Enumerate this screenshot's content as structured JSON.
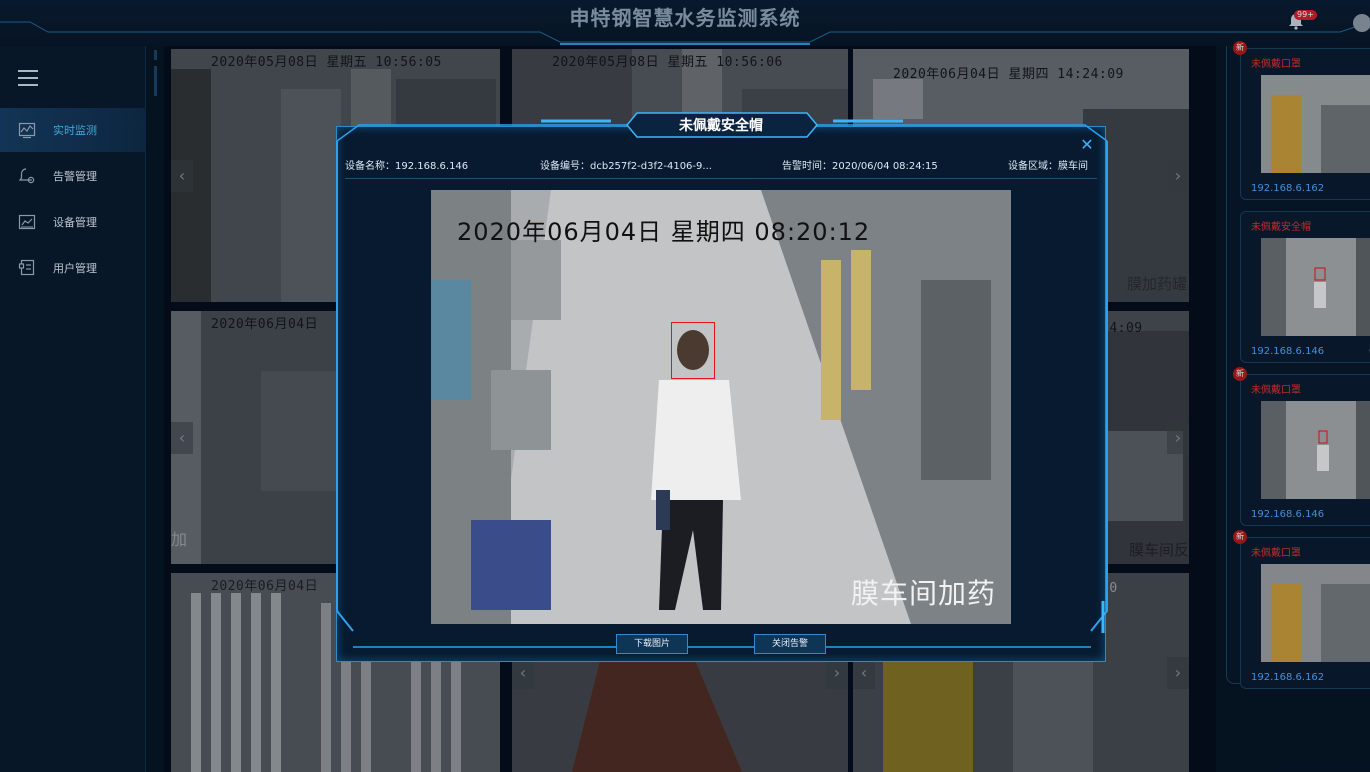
{
  "header": {
    "title": "申特钢智慧水务监测系统",
    "notification_badge": "99+",
    "bell_icon": "bell-icon",
    "avatar_icon": "user-avatar-icon"
  },
  "sidebar": {
    "menu_icon": "hamburger-menu-icon",
    "items": [
      {
        "label": "实时监测",
        "icon": "monitor-chart-icon",
        "active": true
      },
      {
        "label": "告警管理",
        "icon": "alarm-gear-icon",
        "active": false
      },
      {
        "label": "设备管理",
        "icon": "device-chart-icon",
        "active": false
      },
      {
        "label": "用户管理",
        "icon": "user-list-icon",
        "active": false
      }
    ]
  },
  "camera_grid": {
    "tiles": [
      {
        "timestamp": "2020年05月08日 星期五 10:56:05",
        "area_label": ""
      },
      {
        "timestamp": "2020年05月08日 星期五 10:56:06",
        "area_label": ""
      },
      {
        "timestamp": "2020年06月04日 星期四 14:24:09",
        "area_label": "膜加药罐"
      },
      {
        "timestamp": "2020年06月04日",
        "area_label": "加"
      },
      {
        "timestamp": "",
        "area_label": ""
      },
      {
        "timestamp": "24:09",
        "area_label": "膜车间反"
      },
      {
        "timestamp": "2020年06月04日",
        "area_label": ""
      },
      {
        "timestamp": "",
        "area_label": ""
      },
      {
        "timestamp": "10",
        "area_label": ""
      }
    ],
    "prev_arrow": "‹",
    "next_arrow": "›"
  },
  "alerts": [
    {
      "new_tag": "新",
      "type": "未佩戴口罩",
      "ip": "192.168.6.162",
      "extra": "1"
    },
    {
      "new_tag": "新",
      "type": "未佩戴安全帽",
      "ip": "192.168.6.146",
      "extra": "0"
    },
    {
      "new_tag": "新",
      "type": "未佩戴口罩",
      "ip": "192.168.6.146",
      "extra": "1"
    },
    {
      "new_tag": "新",
      "type": "未佩戴口罩",
      "ip": "192.168.6.162",
      "extra": "17"
    }
  ],
  "modal": {
    "title": "未佩戴安全帽",
    "close_symbol": "✕",
    "device_name_label": "设备名称：",
    "device_name": "192.168.6.146",
    "device_id_label": "设备编号：",
    "device_id": "dcb257f2-d3f2-4106-9...",
    "alarm_time_label": "告警时间：",
    "alarm_time": "2020/06/04 08:24:15",
    "device_area_label": "设备区域：",
    "device_area": "膜车间",
    "photo_timestamp": "2020年06月04日 星期四 08:20:12",
    "photo_area": "膜车间加药",
    "download_button": "下载图片",
    "close_alarm_button": "关闭告警"
  },
  "colors": {
    "accent": "#3bb3ff",
    "alert_red": "#e0342f",
    "ip_blue": "#4fa6ff",
    "panel_bg": "#071a30"
  }
}
